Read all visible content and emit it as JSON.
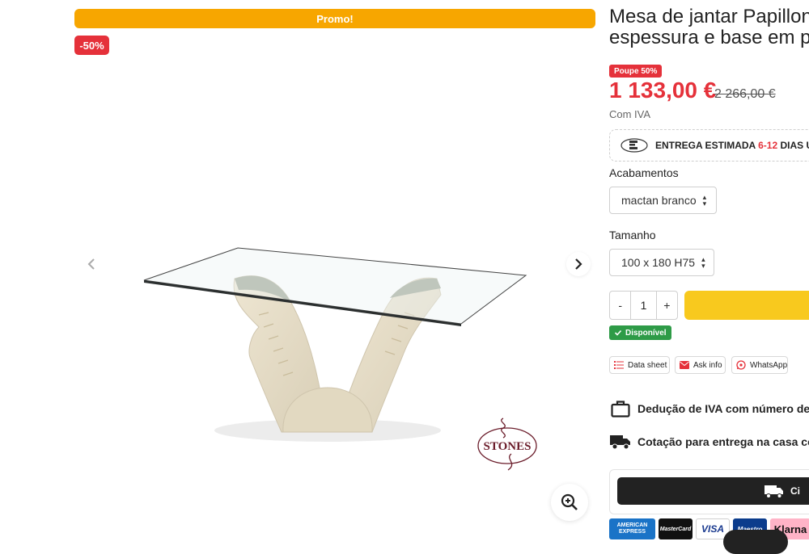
{
  "gallery": {
    "promo_label": "Promo!",
    "discount_badge": "-50%",
    "brand_logo_text": "STONES"
  },
  "product": {
    "title_line1": "Mesa de jantar Papillon co",
    "title_line2": "espessura e base em ped",
    "save_badge": "Poupe 50%",
    "price_current": "1 133,00 €",
    "price_old": "2 266,00 €",
    "tax_note": "Com IVA"
  },
  "delivery": {
    "prefix": "ENTREGA ESTIMADA",
    "range": "6-12",
    "suffix": "DIAS ÚT"
  },
  "options": {
    "finish_label": "Acabamentos",
    "finish_value": "mactan branco",
    "size_label": "Tamanho",
    "size_value": "100 x 180 H75"
  },
  "quantity": {
    "minus": "-",
    "value": "1",
    "plus": "+"
  },
  "availability": "Disponível",
  "actions": {
    "datasheet": "Data sheet",
    "ask_info": "Ask info",
    "whatsapp": "WhatsApp"
  },
  "info": {
    "vat": "Dedução de IVA com número de IVA",
    "home_delivery": "Cotação para entrega na casa com"
  },
  "quote_button": {
    "label": "Ci"
  },
  "payments": {
    "amex_line1": "AMERICAN",
    "amex_line2": "EXPRESS",
    "mastercard": "MasterCard",
    "visa": "VISA",
    "maestro": "Maestro",
    "klarna": "Klarna"
  },
  "colors": {
    "promo": "#f7a600",
    "sale_red": "#e5313a",
    "add_to_cart": "#f8c91e",
    "available_green": "#2e9b47"
  }
}
